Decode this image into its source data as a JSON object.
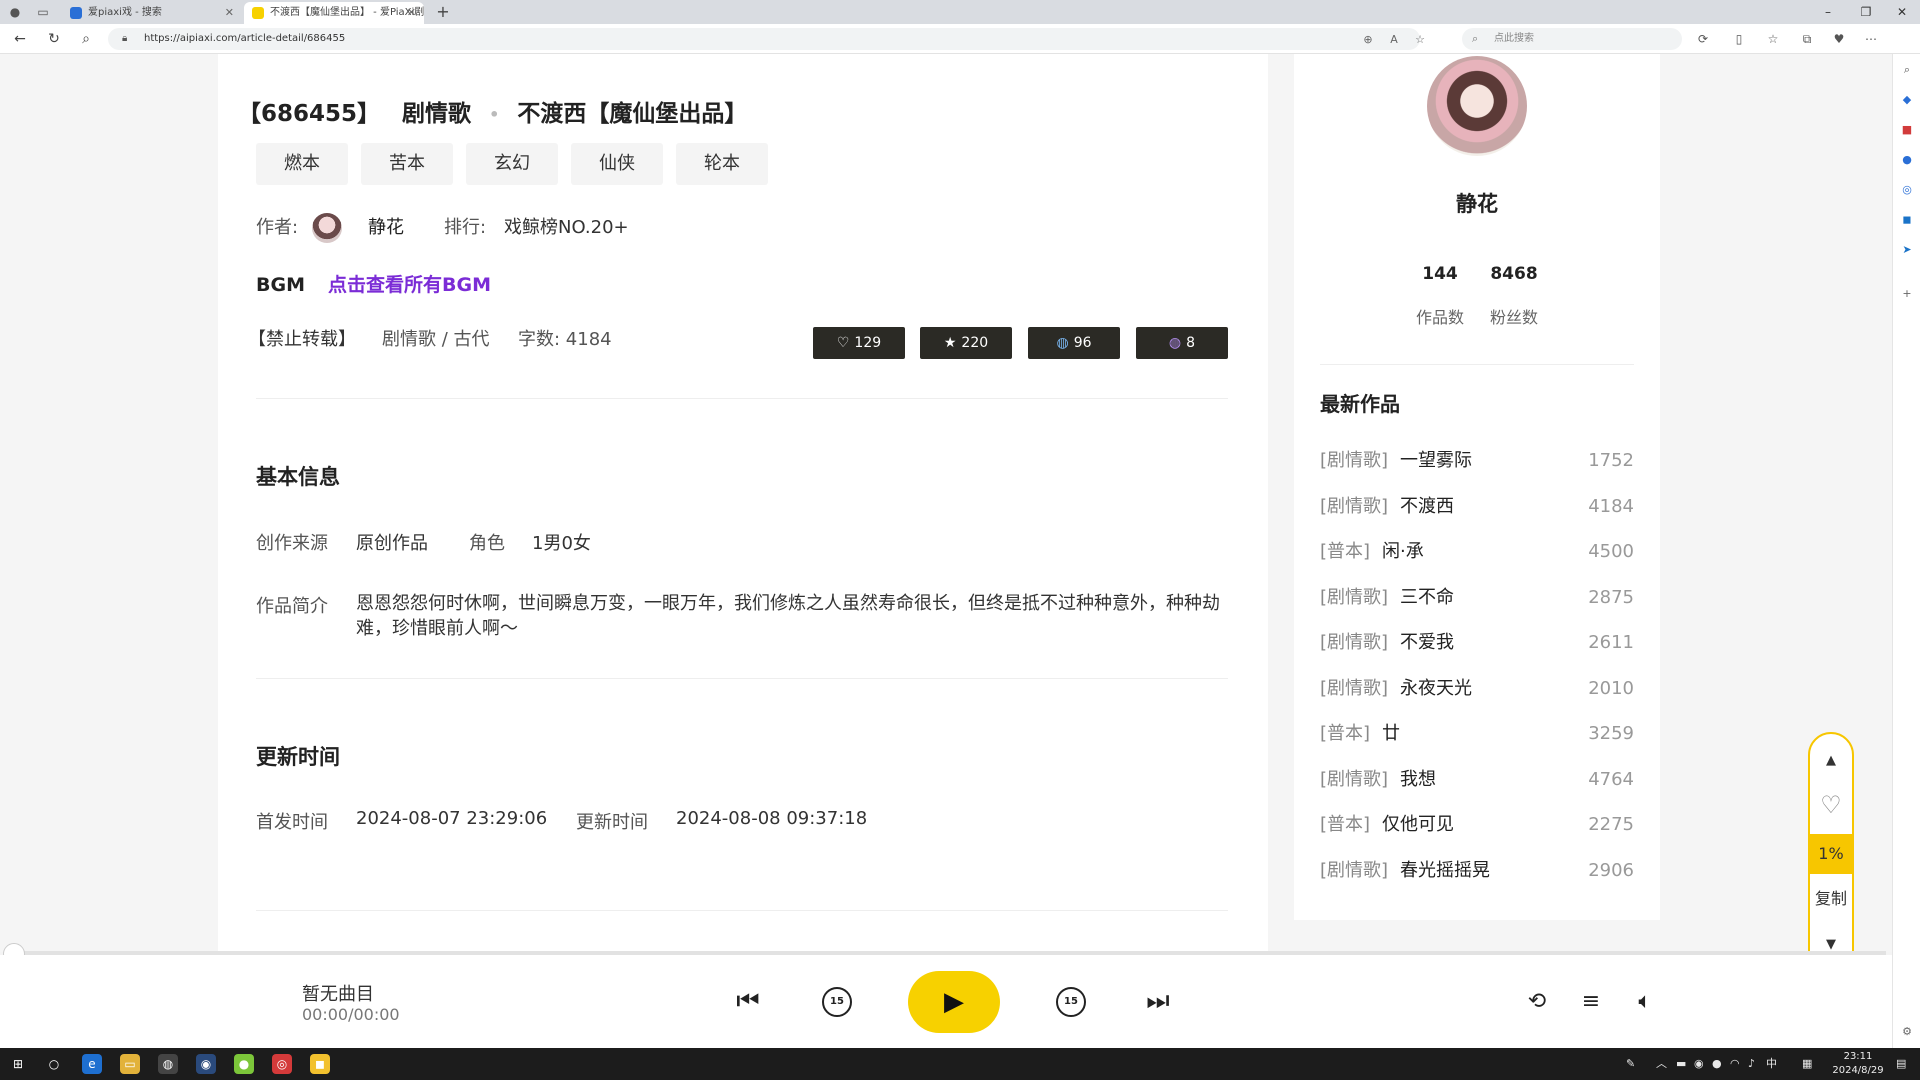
{
  "browser": {
    "tabs": [
      {
        "label": "爱piaxi戏 - 搜索",
        "active": false
      },
      {
        "label": "不渡西【魔仙堡出品】 - 爱PiaXi剧本",
        "active": true
      }
    ],
    "url": "https://aipiaxi.com/article-detail/686455",
    "search_placeholder": "点此搜索",
    "new_tab": "+",
    "icons": [
      "back-icon",
      "refresh-icon",
      "search-icon",
      "lock-icon",
      "zoom-icon",
      "read-aloud-icon",
      "favorite-star-icon",
      "extensions-icon",
      "split-screen-icon",
      "favorites-icon",
      "collections-icon",
      "browser-essentials-icon",
      "more-icon"
    ]
  },
  "article": {
    "title_id": "【686455】",
    "title_type": "剧情歌",
    "title_dot": "•",
    "title_name": "不渡西【魔仙堡出品】",
    "tags": [
      "燃本",
      "苦本",
      "玄幻",
      "仙侠",
      "轮本"
    ],
    "author_label": "作者:",
    "author_name": "静花",
    "rank_label": "排行:",
    "rank_value": "戏鲸榜NO.20+",
    "bgm_label": "BGM",
    "bgm_link": "点击查看所有BGM",
    "no_repost": "【禁止转载】",
    "category": "剧情歌 / 古代",
    "word_count": "字数: 4184",
    "stats": [
      {
        "icon": "heart-icon",
        "glyph": "♡",
        "value": "129"
      },
      {
        "icon": "star-icon",
        "glyph": "★",
        "value": "220"
      },
      {
        "icon": "globe-icon",
        "glyph": "◍",
        "value": "96"
      },
      {
        "icon": "gift-icon",
        "glyph": "◍",
        "value": "8"
      }
    ]
  },
  "basic_info": {
    "heading": "基本信息",
    "source_label": "创作来源",
    "source_value": "原创作品",
    "role_label": "角色",
    "role_value": "1男0女",
    "intro_label": "作品简介",
    "intro_text": "恩恩怨怨何时休啊，世间瞬息万变，一眼万年，我们修炼之人虽然寿命很长，但终是抵不过种种意外，种种劫难，珍惜眼前人啊～"
  },
  "update_info": {
    "heading": "更新时间",
    "first_label": "首发时间",
    "first_value": "2024-08-07 23:29:06",
    "update_label": "更新时间",
    "update_value": "2024-08-08 09:37:18"
  },
  "sidebar": {
    "name": "静花",
    "works_count": "144",
    "works_label": "作品数",
    "fans_count": "8468",
    "fans_label": "粉丝数",
    "latest_heading": "最新作品",
    "works": [
      {
        "cat": "[剧情歌]",
        "title": "一望雾际",
        "count": "1752"
      },
      {
        "cat": "[剧情歌]",
        "title": "不渡西",
        "count": "4184"
      },
      {
        "cat": "[普本]",
        "title": "闲·承",
        "count": "4500"
      },
      {
        "cat": "[剧情歌]",
        "title": "三不命",
        "count": "2875"
      },
      {
        "cat": "[剧情歌]",
        "title": "不爱我",
        "count": "2611"
      },
      {
        "cat": "[剧情歌]",
        "title": "永夜天光",
        "count": "2010"
      },
      {
        "cat": "[普本]",
        "title": "廿",
        "count": "3259"
      },
      {
        "cat": "[剧情歌]",
        "title": "我想",
        "count": "4764"
      },
      {
        "cat": "[普本]",
        "title": "仅他可见",
        "count": "2275"
      },
      {
        "cat": "[剧情歌]",
        "title": "春光摇摇晃",
        "count": "2906"
      }
    ]
  },
  "float_control": {
    "up": "▲",
    "like": "♡",
    "percent": "1%",
    "copy": "复制",
    "down": "▼"
  },
  "player": {
    "track_title": "暂无曲目",
    "track_time": "00:00/00:00",
    "skip_back": "15",
    "skip_forward": "15",
    "progress": 0
  },
  "taskbar": {
    "time": "23:11",
    "date": "2024/8/29",
    "ime": "中"
  },
  "colors": {
    "accent_yellow": "#f7d100",
    "link_purple": "#7b2cd6",
    "stat_button": "#2b2a25"
  }
}
